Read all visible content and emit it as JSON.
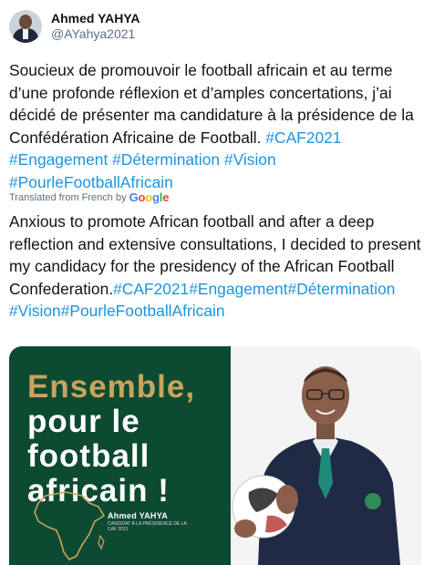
{
  "tweet": {
    "author_name": "Ahmed YAHYA",
    "author_handle": "@AYahya2021",
    "original_text": "Soucieux de promouvoir le football africain et au terme d’une profonde réflexion et d’amples concertations, j’ai décidé de présenter ma candidature à la présidence de la Confédération Africaine de Football.",
    "original_hashtags": [
      "#CAF2021",
      "#Engagement",
      "#Détermination",
      "#Vision",
      "#PourleFootballAfricain"
    ],
    "translated_label": "Translated from French by",
    "translator_brand": "Google",
    "translated_text_1": "Anxious to promote African football and after a deep reflection and extensive consultations, I decided to present my candidacy for the presidency of the African Football",
    "translated_text_2": "Confederation.",
    "translated_hashtags": [
      "#CAF2021",
      "#Engagement",
      "#Détermination",
      "#Vision",
      "#PourleFootballAfricain"
    ]
  },
  "media": {
    "poster_line1": "Ensemble,",
    "poster_line2": "pour le",
    "poster_line3": "football",
    "poster_line4": "africain !",
    "poster_name": "Ahmed YAHYA",
    "poster_subtitle": "CANDIDAT À LA PRÉSIDENCE DE LA CAF 2021"
  },
  "colors": {
    "link": "#1b95e0",
    "poster_green": "#0d4a32",
    "poster_gold": "#c9a45c"
  }
}
